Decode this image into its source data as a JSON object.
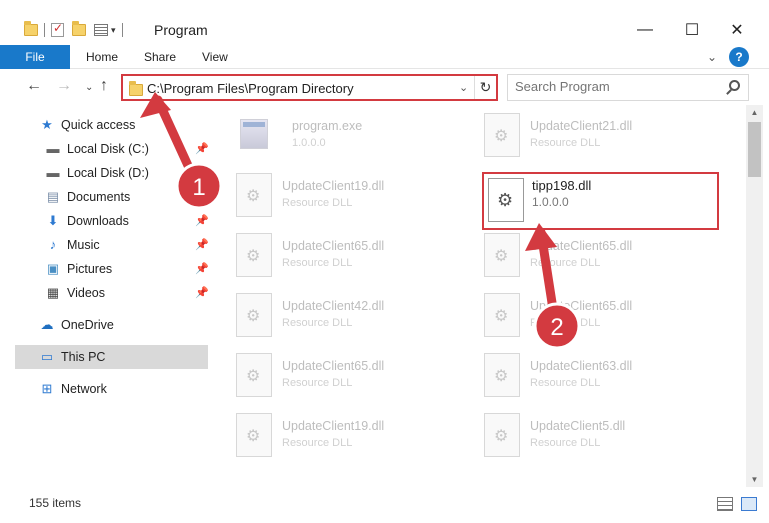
{
  "window": {
    "title": "Program"
  },
  "titlebar": {
    "qa_icons": [
      "folder-icon",
      "properties-check-icon",
      "new-folder-icon",
      "properties-icon"
    ],
    "minimize": "—",
    "maximize": "☐",
    "close": "✕"
  },
  "ribbon": {
    "tabs": [
      "File",
      "Home",
      "Share",
      "View"
    ],
    "help": "?"
  },
  "nav": {
    "address": "C:\\Program Files\\Program Directory",
    "search_placeholder": "Search Program"
  },
  "sidebar": {
    "quick_access": "Quick access",
    "items": [
      {
        "label": "Local Disk (C:)",
        "icon": "drive-icon",
        "pinned": true
      },
      {
        "label": "Local Disk (D:)",
        "icon": "drive-icon",
        "pinned": false
      },
      {
        "label": "Documents",
        "icon": "documents-icon",
        "pinned": true
      },
      {
        "label": "Downloads",
        "icon": "downloads-icon",
        "pinned": true
      },
      {
        "label": "Music",
        "icon": "music-icon",
        "pinned": true
      },
      {
        "label": "Pictures",
        "icon": "pictures-icon",
        "pinned": true
      },
      {
        "label": "Videos",
        "icon": "videos-icon",
        "pinned": true
      }
    ],
    "onedrive": "OneDrive",
    "this_pc": "This PC",
    "network": "Network"
  },
  "files": {
    "left": [
      {
        "name": "program.exe",
        "type": "1.0.0.0"
      },
      {
        "name": "UpdateClient19.dll",
        "type": "Resource DLL"
      },
      {
        "name": "UpdateClient65.dll",
        "type": "Resource DLL"
      },
      {
        "name": "UpdateClient42.dll",
        "type": "Resource DLL"
      },
      {
        "name": "UpdateClient65.dll",
        "type": "Resource DLL"
      },
      {
        "name": "UpdateClient19.dll",
        "type": "Resource DLL"
      }
    ],
    "right": [
      {
        "name": "UpdateClient21.dll",
        "type": "Resource DLL"
      },
      {
        "name": "UpdateClient65.dll",
        "type": "Resource DLL"
      },
      {
        "name": "UpdateClient65.dll",
        "type": "Resource DLL"
      },
      {
        "name": "UpdateClient63.dll",
        "type": "Resource DLL"
      },
      {
        "name": "UpdateClient5.dll",
        "type": "Resource DLL"
      }
    ],
    "highlighted": {
      "name": "tipp198.dll",
      "version": "1.0.0.0"
    }
  },
  "annotations": {
    "marker1": "1",
    "marker2": "2",
    "color": "#d33a40"
  },
  "status": {
    "items": "155 items"
  }
}
